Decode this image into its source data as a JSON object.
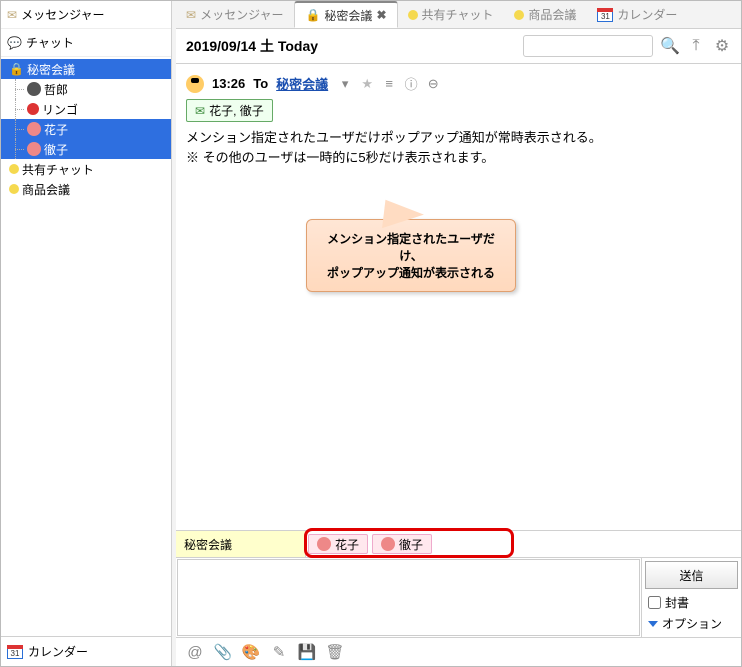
{
  "sidebar": {
    "messenger": "メッセンジャー",
    "chat": "チャット",
    "tree": {
      "root": "秘密会議",
      "children": [
        {
          "label": "哲郎",
          "kind": "m",
          "sel": false
        },
        {
          "label": "リンゴ",
          "kind": "apple",
          "sel": false
        },
        {
          "label": "花子",
          "kind": "f",
          "sel": true
        },
        {
          "label": "徹子",
          "kind": "f",
          "sel": true
        }
      ],
      "extras": [
        "共有チャット",
        "商品会議"
      ]
    },
    "calendar": "カレンダー",
    "cal_num": "31"
  },
  "tabs": [
    {
      "icon": "envelope",
      "label": "メッセンジャー",
      "active": false
    },
    {
      "icon": "lock",
      "label": "秘密会議",
      "active": true,
      "closable": true
    },
    {
      "icon": "dot",
      "label": "共有チャット",
      "active": false
    },
    {
      "icon": "dot",
      "label": "商品会議",
      "active": false
    },
    {
      "icon": "calendar",
      "label": "カレンダー",
      "active": false
    }
  ],
  "date": "2019/09/14 土 Today",
  "message": {
    "time": "13:26",
    "to_label": "To",
    "room": "秘密会議",
    "mentions": "花子, 徹子",
    "body1": "メンション指定されたユーザだけポップアップ通知が常時表示される。",
    "body2": "※ その他のユーザは一時的に5秒だけ表示されます。"
  },
  "callout": {
    "line1": "メンション指定されたユーザだけ、",
    "line2": "ポップアップ通知が表示される"
  },
  "recipients": {
    "label": "秘密会議",
    "chips": [
      "花子",
      "徹子"
    ]
  },
  "compose": {
    "send": "送信",
    "sealed": "封書",
    "options": "オプション"
  }
}
